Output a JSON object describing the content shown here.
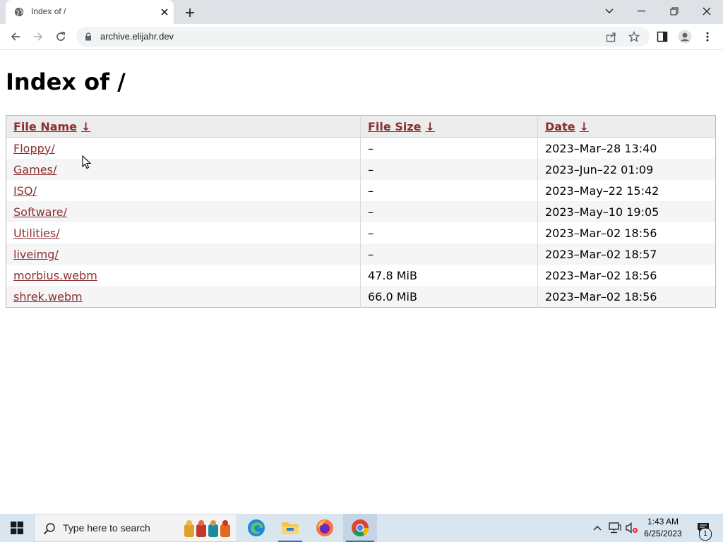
{
  "browser": {
    "tab_title": "Index of /",
    "url": "archive.elijahr.dev"
  },
  "page": {
    "heading": "Index of /",
    "columns": {
      "name": "File Name",
      "size": "File Size",
      "date": "Date",
      "sort_arrow": "↓"
    },
    "rows": [
      {
        "name": "Floppy/",
        "size": "–",
        "date": "2023–Mar–28 13:40"
      },
      {
        "name": "Games/",
        "size": "–",
        "date": "2023–Jun–22 01:09"
      },
      {
        "name": "ISO/",
        "size": "–",
        "date": "2023–May–22 15:42"
      },
      {
        "name": "Software/",
        "size": "–",
        "date": "2023–May–10 19:05"
      },
      {
        "name": "Utilities/",
        "size": "–",
        "date": "2023–Mar–02 18:56"
      },
      {
        "name": "liveimg/",
        "size": "–",
        "date": "2023–Mar–02 18:57"
      },
      {
        "name": "morbius.webm",
        "size": "47.8 MiB",
        "date": "2023–Mar–02 18:56"
      },
      {
        "name": "shrek.webm",
        "size": "66.0 MiB",
        "date": "2023–Mar–02 18:56"
      }
    ]
  },
  "taskbar": {
    "search_placeholder": "Type here to search",
    "time": "1:43 AM",
    "date": "6/25/2023",
    "notification_count": "1",
    "icons": [
      "start-icon",
      "search-icon",
      "people-widget-icon",
      "edge-icon",
      "file-explorer-icon",
      "firefox-icon",
      "chrome-icon"
    ]
  },
  "colors": {
    "link": "#8b2f2f",
    "tabstrip": "#dee1e6",
    "taskbar": "#d9e5ef"
  }
}
